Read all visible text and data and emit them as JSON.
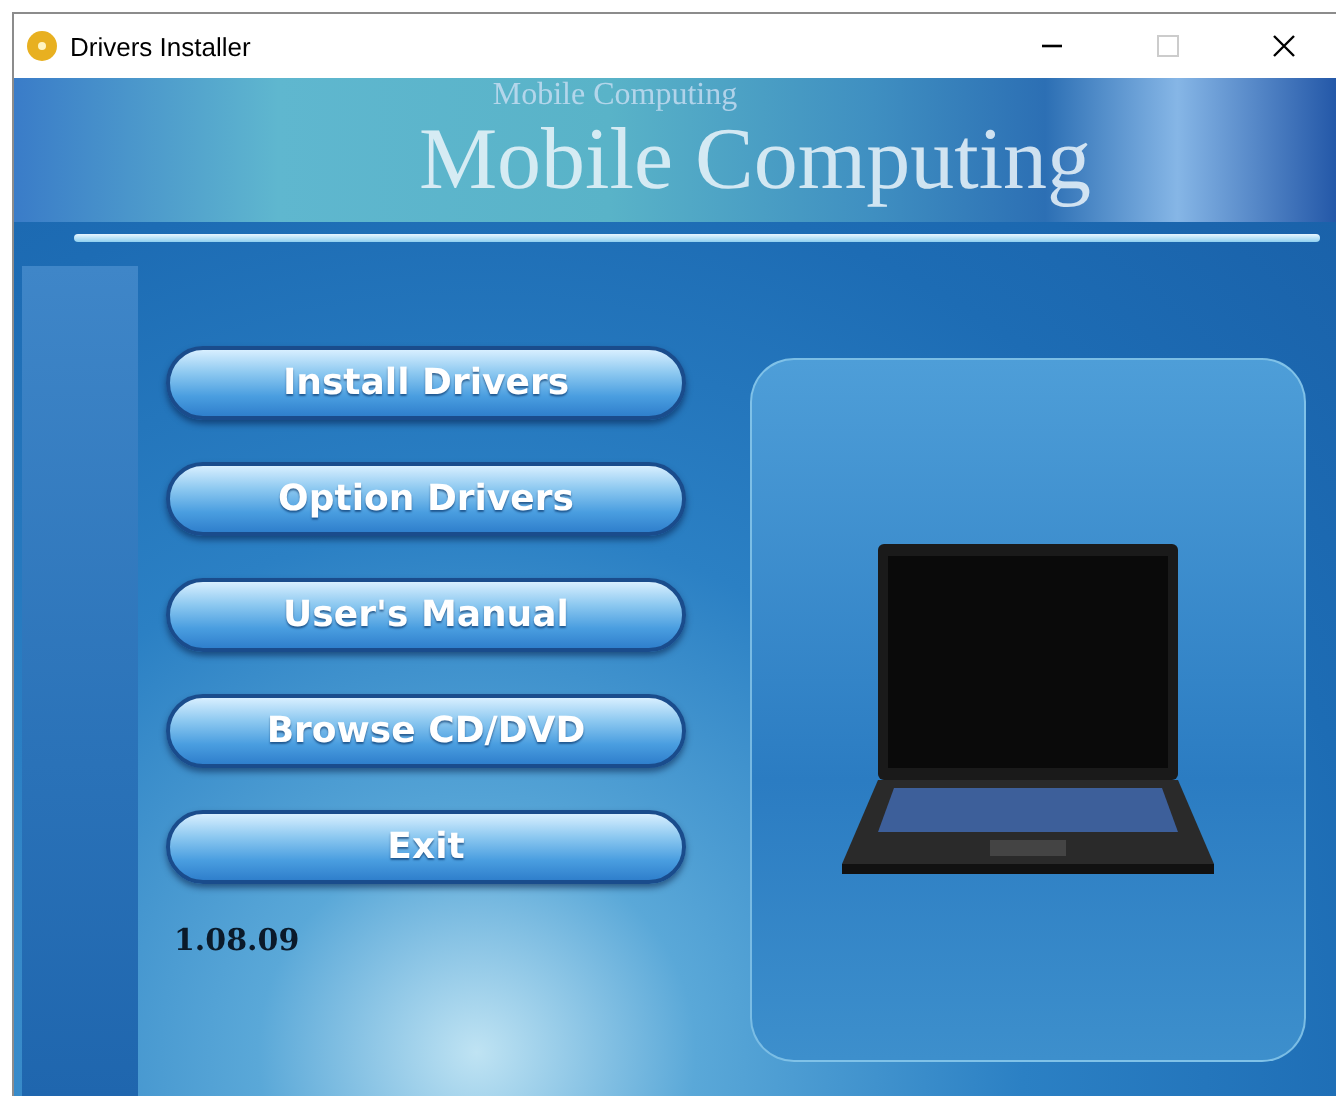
{
  "window": {
    "title": "Drivers Installer"
  },
  "banner": {
    "caption": "Mobile Computing",
    "title": "Mobile Computing"
  },
  "menu": [
    {
      "label": "Install Drivers"
    },
    {
      "label": "Option Drivers"
    },
    {
      "label": "User's Manual"
    },
    {
      "label": "Browse CD/DVD"
    },
    {
      "label": "Exit"
    }
  ],
  "version": "1.08.09"
}
